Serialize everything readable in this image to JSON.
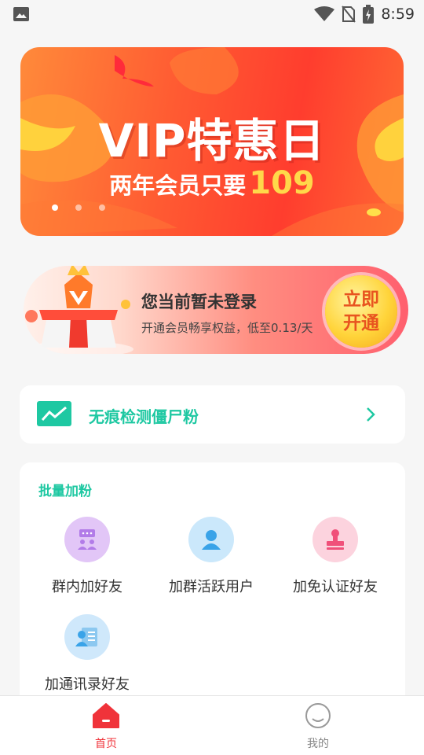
{
  "status_bar": {
    "time": "8:59",
    "icons": [
      "photo-icon",
      "wifi-icon",
      "no-sim-icon",
      "battery-charging-icon"
    ]
  },
  "banner": {
    "title": "VIP特惠日",
    "subtitle": "两年会员只要",
    "price": "109",
    "pager_count": 3,
    "active_index": 0
  },
  "login_card": {
    "title": "您当前暂未登录",
    "subtitle": "开通会员畅享权益，低至0.13/天",
    "button_line1": "立即",
    "button_line2": "开通"
  },
  "detect_row": {
    "label": "无痕检测僵尸粉",
    "icon": "trend-chart-icon"
  },
  "batch": {
    "title": "批量加粉",
    "items": [
      {
        "label": "群内加好友",
        "icon": "group-chat-icon",
        "color": "#e2c6f7"
      },
      {
        "label": "加群活跃用户",
        "icon": "user-icon",
        "color": "#cbe8fb"
      },
      {
        "label": "加免认证好友",
        "icon": "stamp-icon",
        "color": "#fcd3de"
      },
      {
        "label": "加通讯录好友",
        "icon": "contact-card-icon",
        "color": "#cfe8fb"
      }
    ]
  },
  "tab_bar": {
    "tabs": [
      {
        "label": "首页",
        "icon": "home-icon",
        "active": true
      },
      {
        "label": "我的",
        "icon": "profile-icon",
        "active": false
      }
    ],
    "active_color": "#f0333a",
    "inactive_color": "#888888"
  }
}
